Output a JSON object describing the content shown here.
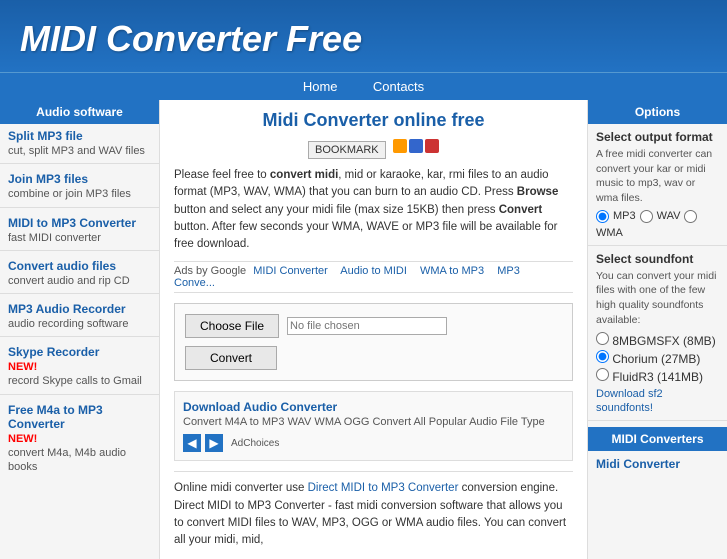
{
  "header": {
    "title": "MIDI Converter Free"
  },
  "nav": {
    "items": [
      {
        "label": "Home",
        "href": "#"
      },
      {
        "label": "Contacts",
        "href": "#"
      }
    ]
  },
  "sidebar": {
    "header": "Audio software",
    "items": [
      {
        "label": "Split MP3 file",
        "desc": "cut, split MP3 and WAV files",
        "new": false
      },
      {
        "label": "Join MP3 files",
        "desc": "combine or join MP3 files",
        "new": false
      },
      {
        "label": "MIDI to MP3 Converter",
        "desc": "fast MIDI converter",
        "new": false
      },
      {
        "label": "Convert audio files",
        "desc": "convert audio and rip CD",
        "new": false
      },
      {
        "label": "MP3 Audio Recorder",
        "desc": "audio recording software",
        "new": false
      },
      {
        "label": "Skype Recorder",
        "desc": "record Skype calls to Gmail",
        "new": true
      },
      {
        "label": "Free M4a to MP3 Converter",
        "desc": "convert M4a, M4b audio books",
        "new": true
      }
    ]
  },
  "content": {
    "title": "Midi Converter online free",
    "bookmark_label": "BOOKMARK",
    "info_text": "Please feel free to convert midi, mid or karaoke, kar, rmi files to an audio format (MP3, WAV, WMA) that you can burn to an audio CD. Press Browse button and select any your midi file (max size 15KB) then press Convert button. After few seconds your WMA, WAVE or MP3 file will be available for free download.",
    "ads_label": "Ads by Google",
    "ads_links": [
      "MIDI Converter",
      "Audio to MIDI",
      "WMA to MP3",
      "MP3 Conve..."
    ],
    "choose_file_label": "Choose File",
    "convert_label": "Convert",
    "ad_title": "Download Audio Converter",
    "ad_desc": "Convert M4A to MP3 WAV WMA OGG Convert All Popular Audio File Type",
    "ad_choices": "AdChoices",
    "bottom_text1": "Online midi converter use ",
    "bottom_link1": "Direct MIDI to MP3 Converter",
    "bottom_text2": " conversion engine. Direct MIDI to MP3 Converter - fast midi conversion software that allows you to convert MIDI files to WAV, MP3, OGG or WMA audio files. You can convert all your midi, mid,"
  },
  "right_sidebar": {
    "options_header": "Options",
    "output_format_title": "Select output format",
    "output_format_desc": "A free midi converter can convert your kar or midi music to mp3, wav or wma files.",
    "format_options": [
      "MP3",
      "WAV",
      "WMA"
    ],
    "selected_format": "MP3",
    "soundfont_title": "Select soundfont",
    "soundfont_desc": "You can convert your midi files with one of the few high quality soundfonts available:",
    "soundfont_options": [
      "8MBGMSFX (8MB)",
      "Chorium (27MB)",
      "FluidR3 (141MB)"
    ],
    "selected_soundfont": "Chorium (27MB)",
    "download_sf_link": "Download sf2 soundfonts!",
    "midi_converters_header": "MIDI Converters",
    "midi_converter_link": "Midi Converter"
  }
}
